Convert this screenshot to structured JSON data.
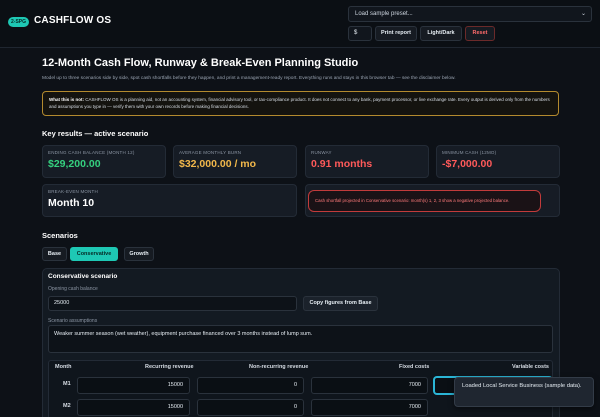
{
  "app": {
    "badge": "2-SPG",
    "name": "CASHFLOW OS"
  },
  "toolbar": {
    "preset_placeholder": "Load sample preset...",
    "currency": "$",
    "print_label": "Print report",
    "theme_label": "Light/Dark",
    "reset_label": "Reset"
  },
  "page": {
    "title": "12-Month Cash Flow, Runway & Break-Even Planning Studio",
    "subtitle": "Model up to three scenarios side by side, spot cash shortfalls before they happen, and print a management-ready report. Everything runs and stays in this browser tab — see the disclaimer below.",
    "notice_heading": "What this is not:",
    "notice_text": "CASHFLOW OS is a planning aid, not an accounting system, financial advisory tool, or tax-compliance product. It does not connect to any bank, payment processor, or live exchange rate. Every output is derived only from the numbers and assumptions you type in — verify them with your own records before making financial decisions."
  },
  "results": {
    "heading": "Key results — active scenario",
    "ending_cash": {
      "label": "ENDING CASH BALANCE (MONTH 12)",
      "value": "$29,200.00"
    },
    "avg_burn": {
      "label": "AVERAGE MONTHLY BURN",
      "value": "$32,000.00 / mo"
    },
    "runway": {
      "label": "RUNWAY",
      "value": "0.91 months"
    },
    "min_cash": {
      "label": "MINIMUM CASH (12MO)",
      "value": "-$7,000.00"
    },
    "break_even": {
      "label": "BREAK-EVEN MONTH",
      "value": "Month 10"
    },
    "alert": "Cash shortfall projected in Conservative scenario: month(s) 1, 2, 3 show a negative projected balance."
  },
  "scenarios": {
    "heading": "Scenarios",
    "tabs": [
      "Base",
      "Conservative",
      "Growth"
    ],
    "active_tab": "Conservative"
  },
  "editor": {
    "title": "Conservative scenario",
    "opening_label": "Opening cash balance",
    "opening_value": "25000",
    "copy_label": "Copy figures from Base",
    "assumptions_label": "Scenario assumptions",
    "assumptions_value": "Weaker summer season (wet weather), equipment purchase financed over 3 months instead of lump sum."
  },
  "table": {
    "headers": [
      "Month",
      "Recurring revenue",
      "Non-recurring revenue",
      "Fixed costs",
      "Variable costs"
    ],
    "rows": [
      {
        "month": "M1",
        "recurring": "15000",
        "nonrecurring": "0",
        "fixed": "7000",
        "variable": ""
      },
      {
        "month": "M2",
        "recurring": "15000",
        "nonrecurring": "0",
        "fixed": "7000",
        "variable": ""
      }
    ]
  },
  "toast": "Loaded Local Service Business (sample data)."
}
